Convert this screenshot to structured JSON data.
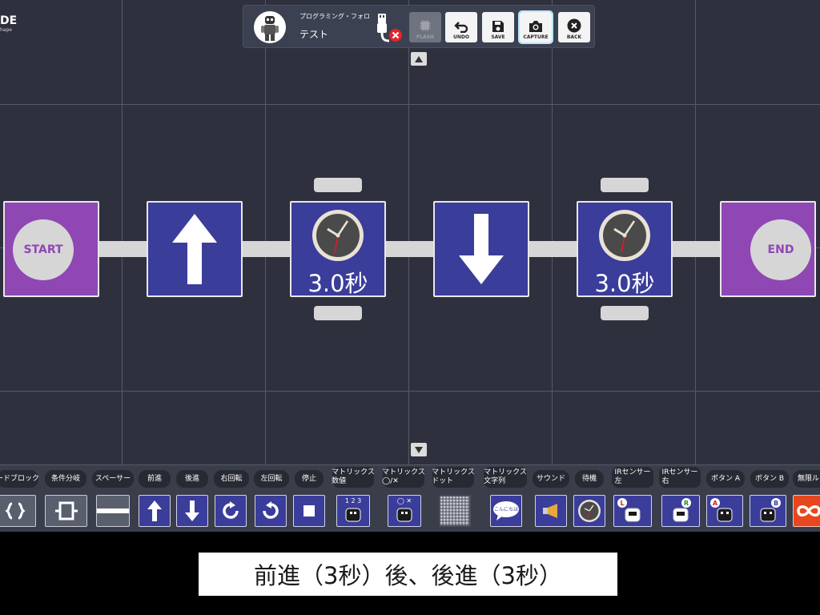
{
  "app": {
    "logo": "DE",
    "logo_sub": "hape"
  },
  "header": {
    "robot_name": "プログラミング・フォロ",
    "project_name": "テスト",
    "buttons": [
      {
        "label": "FLASH",
        "icon": "chip-icon",
        "state": "disabled"
      },
      {
        "label": "UNDO",
        "icon": "undo-icon",
        "state": "normal"
      },
      {
        "label": "SAVE",
        "icon": "save-icon",
        "state": "normal"
      },
      {
        "label": "CAPTURE",
        "icon": "camera-icon",
        "state": "active"
      },
      {
        "label": "BACK",
        "icon": "close-icon",
        "state": "normal"
      }
    ]
  },
  "program": {
    "blocks": [
      {
        "type": "start",
        "label": "START"
      },
      {
        "type": "forward",
        "icon": "arrow-up-icon"
      },
      {
        "type": "wait",
        "label": "3.0秒",
        "icon": "clock-icon"
      },
      {
        "type": "backward",
        "icon": "arrow-down-icon"
      },
      {
        "type": "wait",
        "label": "3.0秒",
        "icon": "clock-icon"
      },
      {
        "type": "end",
        "label": "END"
      }
    ]
  },
  "palette": {
    "items": [
      {
        "label": "ードブロック"
      },
      {
        "label": "条件分岐"
      },
      {
        "label": "スペーサー"
      },
      {
        "label": "前進"
      },
      {
        "label": "後進"
      },
      {
        "label": "右回転"
      },
      {
        "label": "左回転"
      },
      {
        "label": "停止"
      },
      {
        "label_line1": "マトリックス",
        "label_line2": "数値"
      },
      {
        "label_line1": "マトリックス",
        "label_line2": "◯/✕"
      },
      {
        "label_line1": "マトリックス",
        "label_line2": "ドット"
      },
      {
        "label_line1": "マトリックス",
        "label_line2": "文字列"
      },
      {
        "label": "サウンド"
      },
      {
        "label": "待機"
      },
      {
        "label_line1": "IRセンサー",
        "label_line2": "左"
      },
      {
        "label_line1": "IRセンサー",
        "label_line2": "右"
      },
      {
        "label": "ボタン A"
      },
      {
        "label": "ボタン B"
      },
      {
        "label": "無限ル"
      }
    ],
    "matrix_number_text": "1 2 3",
    "matrix_ox_text": "◯ ✕",
    "speech_text": "こんにちは",
    "ir_left_badge": "L",
    "ir_right_badge": "R",
    "button_a_badge": "A",
    "button_b_badge": "B"
  },
  "caption": {
    "text": "前進（3秒）後、後進（3秒）"
  },
  "colors": {
    "block_blue": "#3b3d9a",
    "block_purple": "#8f47b3",
    "canvas": "#2e313d",
    "connector": "#d6d6d6"
  }
}
